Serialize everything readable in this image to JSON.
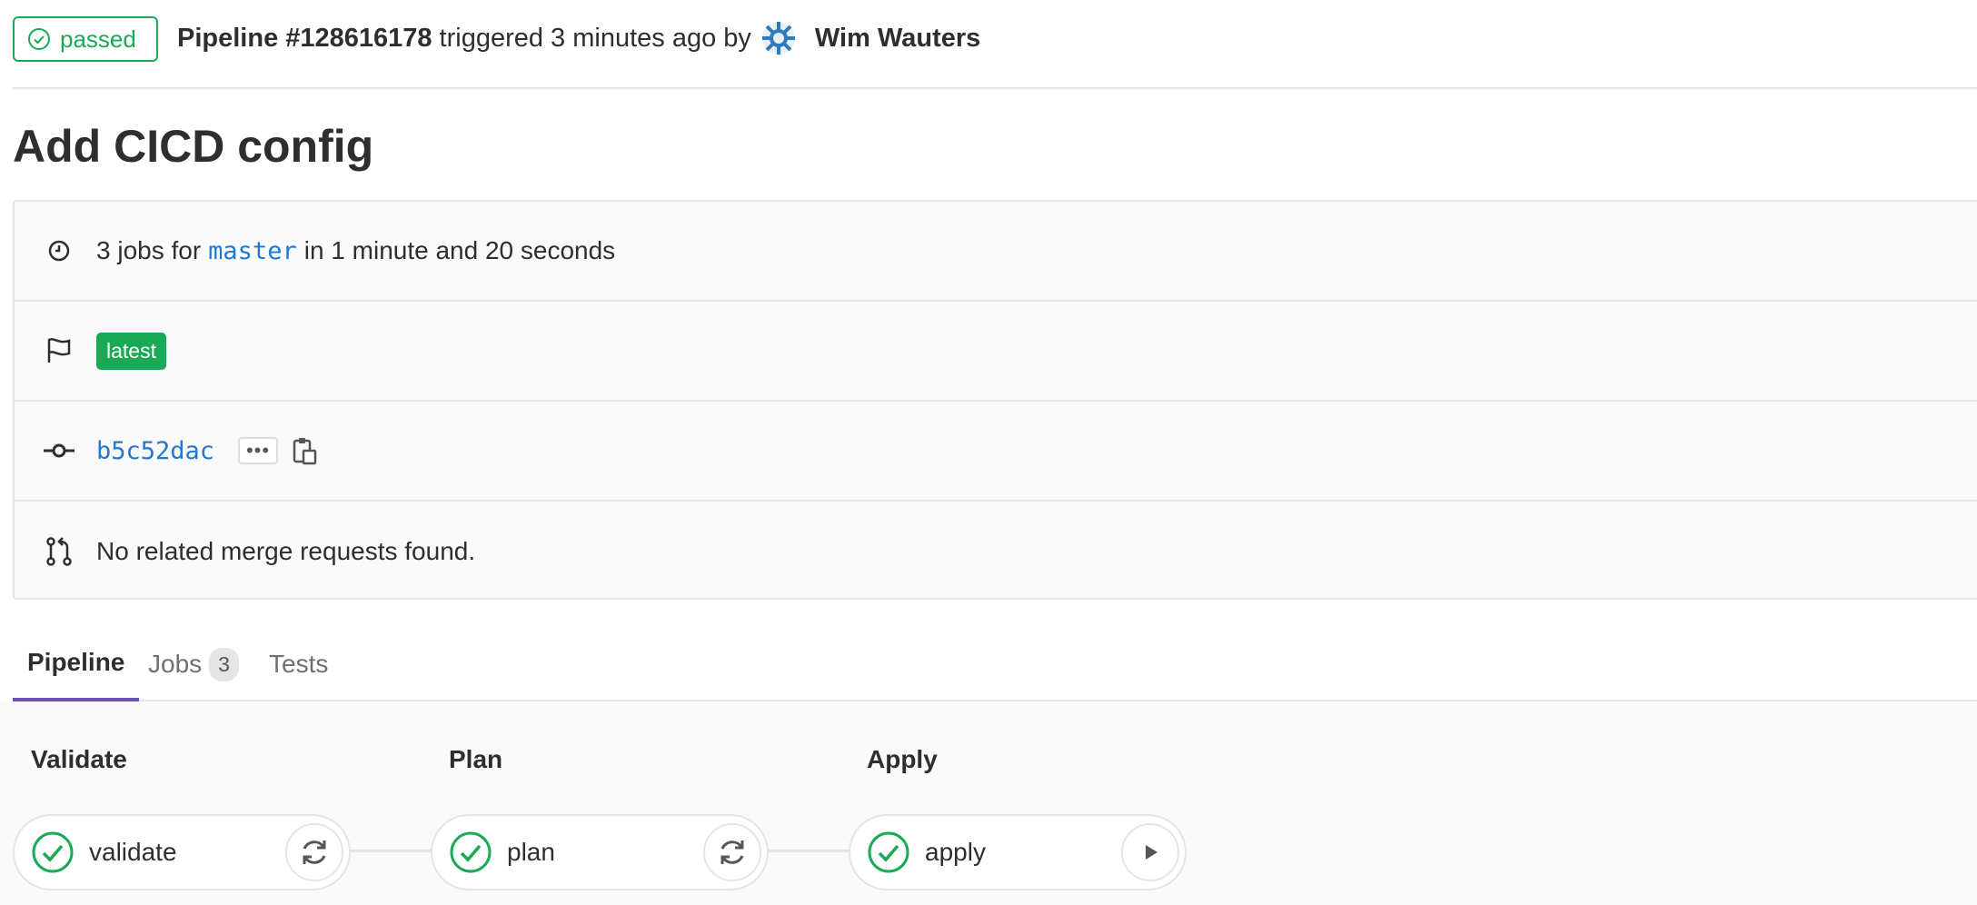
{
  "header": {
    "status": "passed",
    "pipeline_id": "Pipeline #128616178",
    "triggered_text": "triggered 3 minutes ago by",
    "author": "Wim Wauters"
  },
  "title": "Add CICD config",
  "info": {
    "jobs_prefix": "3 jobs for",
    "branch": "master",
    "duration": "in 1 minute and 20 seconds",
    "latest_badge": "latest",
    "commit_sha": "b5c52dac",
    "ellipsis": "•••",
    "merge_requests": "No related merge requests found."
  },
  "tabs": [
    {
      "label": "Pipeline",
      "active": true
    },
    {
      "label": "Jobs",
      "count": "3"
    },
    {
      "label": "Tests"
    }
  ],
  "stages": [
    {
      "title": "Validate",
      "job": "validate",
      "action": "retry-icon"
    },
    {
      "title": "Plan",
      "job": "plan",
      "action": "retry-icon"
    },
    {
      "title": "Apply",
      "job": "apply",
      "action": "play-icon"
    }
  ],
  "colors": {
    "success": "#1aaa55",
    "link": "#1f78d1",
    "tab_active": "#6b4fbb"
  }
}
